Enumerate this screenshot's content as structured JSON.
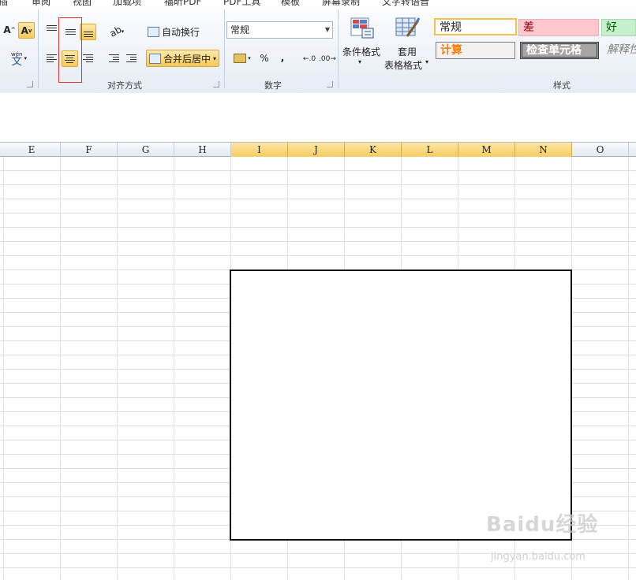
{
  "menu": {
    "items": [
      "插",
      "审阅",
      "视图",
      "加载项",
      "福昕PDF",
      "PDF工具",
      "模板",
      "屏幕录制",
      "文字转语音"
    ]
  },
  "ribbon": {
    "alignment": {
      "wrap_text_label": "自动换行",
      "merge_center_label": "合并后居中",
      "group_label": "对齐方式"
    },
    "number": {
      "format_value": "常规",
      "percent_label": "%",
      "comma_label": ",",
      "group_label": "数字"
    },
    "styles": {
      "conditional_format_label": "条件格式",
      "table_format_line1": "套用",
      "table_format_line2": "表格格式",
      "cells": [
        "常规",
        "差",
        "好",
        "计算",
        "检查单元格",
        "解释性"
      ],
      "group_label": "样式"
    }
  },
  "columns": [
    "E",
    "F",
    "G",
    "H",
    "I",
    "J",
    "K",
    "L",
    "M",
    "N",
    "O"
  ],
  "selected_columns": [
    "I",
    "J",
    "K",
    "L",
    "M",
    "N"
  ],
  "watermark": {
    "brand": "Baidu经验",
    "url": "jingyan.baidu.com"
  },
  "colors": {
    "selection_header": "#f5cc63",
    "highlight_red": "#e0312d",
    "style_bad_bg": "#ffc7ce",
    "style_good_bg": "#c6efce",
    "style_calc_text": "#fa7d00"
  }
}
